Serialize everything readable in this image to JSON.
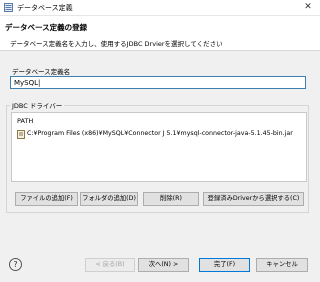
{
  "window": {
    "title": "データベース定義",
    "close_glyph": "✕"
  },
  "header": {
    "title": "データベース定義の登録",
    "message": "データベース定義名を入力し、使用するJDBC Drvierを選択してください"
  },
  "form": {
    "dbname_label": "データベース定義名",
    "dbname_value": "MySQL|"
  },
  "jdbc": {
    "group_label": "JDBC ドライバー",
    "column_header": "PATH",
    "rows": [
      {
        "path": "C:¥Program Files (x86)¥MySQL¥Connector J 5.1¥mysql-connector-java-5.1.45-bin.jar"
      }
    ],
    "buttons": {
      "add_file": "ファイルの追加(F)",
      "add_folder": "フォルダの追加(D)",
      "delete": "削除(R)",
      "select_registered": "登録済みDriverから選択する(C)"
    }
  },
  "footer": {
    "help_glyph": "?",
    "back": "< 戻る(B)",
    "next": "次へ(N) >",
    "finish": "完了(F)",
    "cancel": "キャンセル"
  },
  "colors": {
    "accent": "#0078d7",
    "input_border": "#3c7fb1"
  },
  "icons": {
    "app": "database-definition-icon",
    "jar": "jar-file-icon",
    "help": "help-icon",
    "close": "close-icon"
  }
}
